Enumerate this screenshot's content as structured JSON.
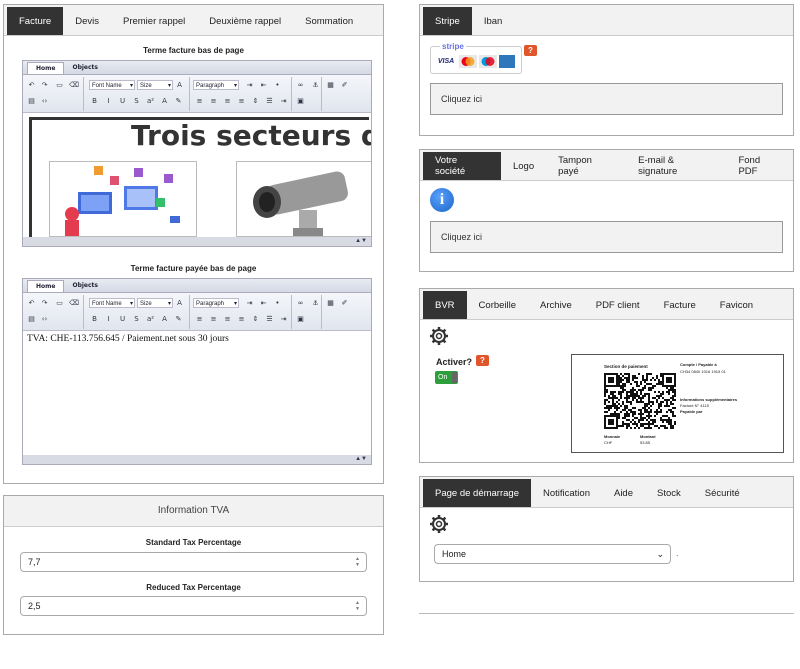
{
  "facture_tabs": [
    "Facture",
    "Devis",
    "Premier rappel",
    "Deuxième rappel",
    "Sommation"
  ],
  "editor1": {
    "label": "Terme facture bas de page",
    "tabs": [
      "Home",
      "Objects"
    ],
    "font": "Font Name",
    "size": "Size",
    "para": "Paragraph",
    "banner": "Trois secteurs d'a"
  },
  "editor2": {
    "label": "Terme facture payée bas de page",
    "tabs": [
      "Home",
      "Objects"
    ],
    "font": "Font Name",
    "size": "Size",
    "para": "Paragraph",
    "content": "TVA: CHE-113.756.645 / Paiement.net sous 30 jours"
  },
  "tva": {
    "title": "Information TVA",
    "standard_label": "Standard Tax Percentage",
    "standard_value": "7,7",
    "reduced_label": "Reduced Tax Percentage",
    "reduced_value": "2,5"
  },
  "stripe_tabs": [
    "Stripe",
    "Iban"
  ],
  "stripe": {
    "logo": "stripe",
    "cards": [
      "VISA",
      "MC",
      "Maestro",
      "AMEX"
    ],
    "click": "Cliquez ici",
    "help": "?"
  },
  "company_tabs": [
    "Votre société",
    "Logo",
    "Tampon payé",
    "E-mail & signature",
    "Fond PDF"
  ],
  "company": {
    "click": "Cliquez ici"
  },
  "bvr_tabs": [
    "BVR",
    "Corbeille",
    "Archive",
    "PDF client",
    "Facture",
    "Favicon"
  ],
  "bvr": {
    "activate": "Activer?",
    "toggle": "On",
    "help": "?",
    "slip_title": "Section de paiement",
    "slip_account": "Compte / Payable à",
    "slip_iban": "CH34 0840 1016 1915 01",
    "slip_info": "Informations supplémentaires",
    "slip_invoice": "Facture N° 4115",
    "slip_payable": "Payable par",
    "slip_currency_label": "Monnaie",
    "slip_currency": "CHF",
    "slip_amount_label": "Montant",
    "slip_amount": "53.85"
  },
  "start_tabs": [
    "Page de démarrage",
    "Notification",
    "Aide",
    "Stock",
    "Sécurité"
  ],
  "start": {
    "select": "Home",
    "dot": "."
  },
  "colors": {
    "active_tab": "#333333",
    "toggle": "#2e9e3c",
    "help": "#e0552a",
    "info": "#1a66c6"
  }
}
